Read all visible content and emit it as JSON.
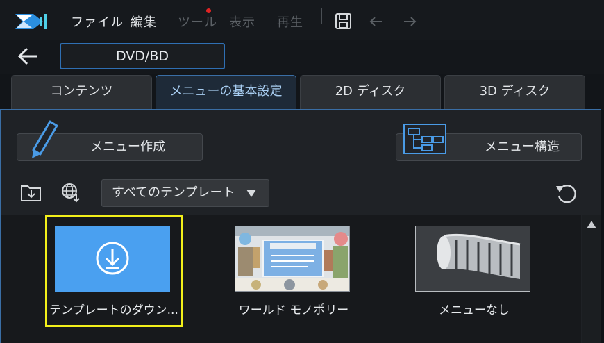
{
  "menubar": {
    "items": [
      {
        "label": "ファイル",
        "enabled": true
      },
      {
        "label": "編集",
        "enabled": true
      },
      {
        "label": "ツール",
        "enabled": false,
        "notification": true
      },
      {
        "label": "表示",
        "enabled": false
      },
      {
        "label": "再生",
        "enabled": false
      }
    ],
    "icons": [
      "save-icon",
      "undo-icon",
      "redo-icon"
    ]
  },
  "header": {
    "project_title": "DVD/BD"
  },
  "tabs": [
    {
      "label": "コンテンツ",
      "active": false
    },
    {
      "label": "メニューの基本設定",
      "active": true
    },
    {
      "label": "2D ディスク",
      "active": false
    },
    {
      "label": "3D ディスク",
      "active": false
    }
  ],
  "actions": {
    "create_menu": "メニュー作成",
    "menu_structure": "メニュー構造"
  },
  "toolbar": {
    "filter_selected": "すべてのテンプレート",
    "icons": [
      "import-icon",
      "online-download-icon",
      "refresh-icon"
    ]
  },
  "templates": [
    {
      "label": "テンプレートのダウン...",
      "kind": "download",
      "selected": true
    },
    {
      "label": "ワールド モノポリー",
      "kind": "thumbnail",
      "selected": false
    },
    {
      "label": "メニューなし",
      "kind": "filmstrip",
      "selected": false
    }
  ],
  "colors": {
    "accent": "#3a6ea5",
    "download_tile": "#4aa0f0",
    "selection": "#f2ef1a",
    "notification": "#e02424"
  }
}
